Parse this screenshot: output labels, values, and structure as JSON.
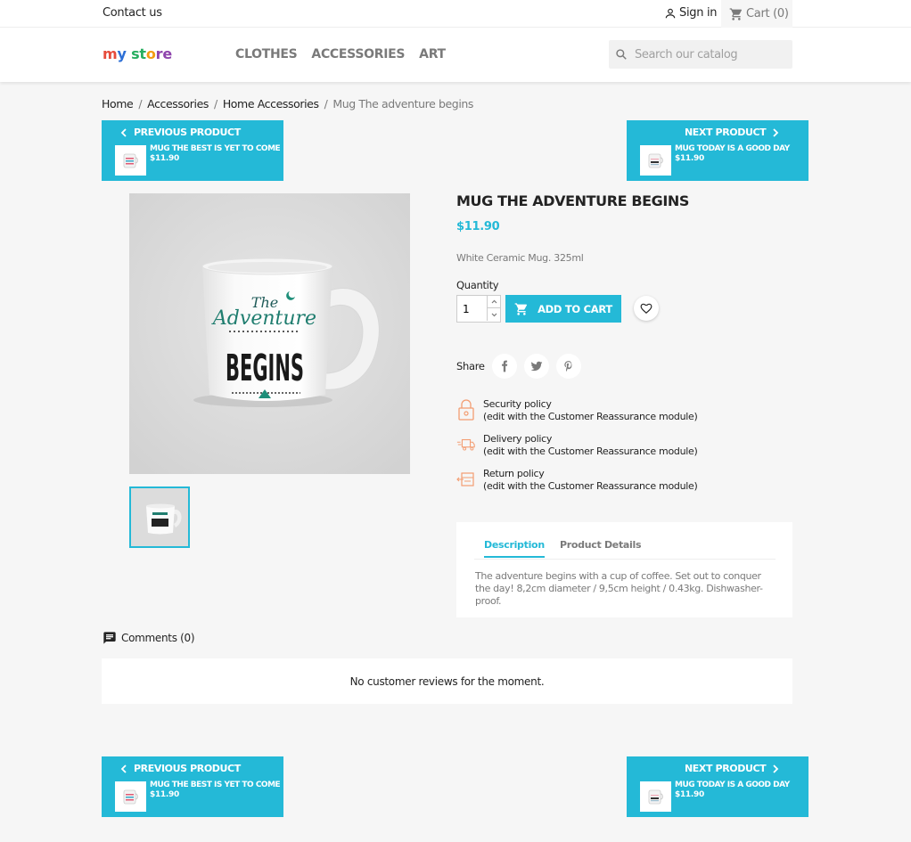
{
  "topbar": {
    "contact": "Contact us",
    "signin": "Sign in",
    "cart": "Cart (0)"
  },
  "header": {
    "logo": {
      "p1": "m",
      "p2": "y",
      "p3": " st",
      "p4": "o",
      "p5": "re"
    },
    "nav": [
      "CLOTHES",
      "ACCESSORIES",
      "ART"
    ],
    "search_placeholder": "Search our catalog"
  },
  "breadcrumb": {
    "items": [
      "Home",
      "Accessories",
      "Home Accessories"
    ],
    "current": "Mug The adventure begins"
  },
  "prev_product": {
    "label": "PREVIOUS PRODUCT",
    "name": "MUG THE BEST IS YET TO COME",
    "price": "$11.90"
  },
  "next_product": {
    "label": "NEXT PRODUCT",
    "name": "MUG TODAY IS A GOOD DAY",
    "price": "$11.90"
  },
  "product": {
    "title": "MUG THE ADVENTURE BEGINS",
    "price": "$11.90",
    "short_desc": "White Ceramic Mug. 325ml",
    "quantity_label": "Quantity",
    "quantity": "1",
    "add_to_cart": "ADD TO CART",
    "mug_text": {
      "line1": "The",
      "line2": "Adventure",
      "line3": "BEGINS"
    }
  },
  "share": {
    "label": "Share",
    "icons": [
      "facebook-icon",
      "twitter-icon",
      "pinterest-icon"
    ]
  },
  "reassurance": [
    {
      "title": "Security policy",
      "sub": "(edit with the Customer Reassurance module)"
    },
    {
      "title": "Delivery policy",
      "sub": "(edit with the Customer Reassurance module)"
    },
    {
      "title": "Return policy",
      "sub": "(edit with the Customer Reassurance module)"
    }
  ],
  "tabs": {
    "description": "Description",
    "details": "Product Details",
    "content": "The adventure begins with a cup of coffee. Set out to conquer the day! 8,2cm diameter / 9,5cm height / 0.43kg. Dishwasher-proof."
  },
  "comments": {
    "header": "Comments (0)",
    "empty": "No customer reviews for the moment."
  },
  "colors": {
    "accent": "#24b9d7",
    "reassurance_icon": "#f39d72"
  }
}
